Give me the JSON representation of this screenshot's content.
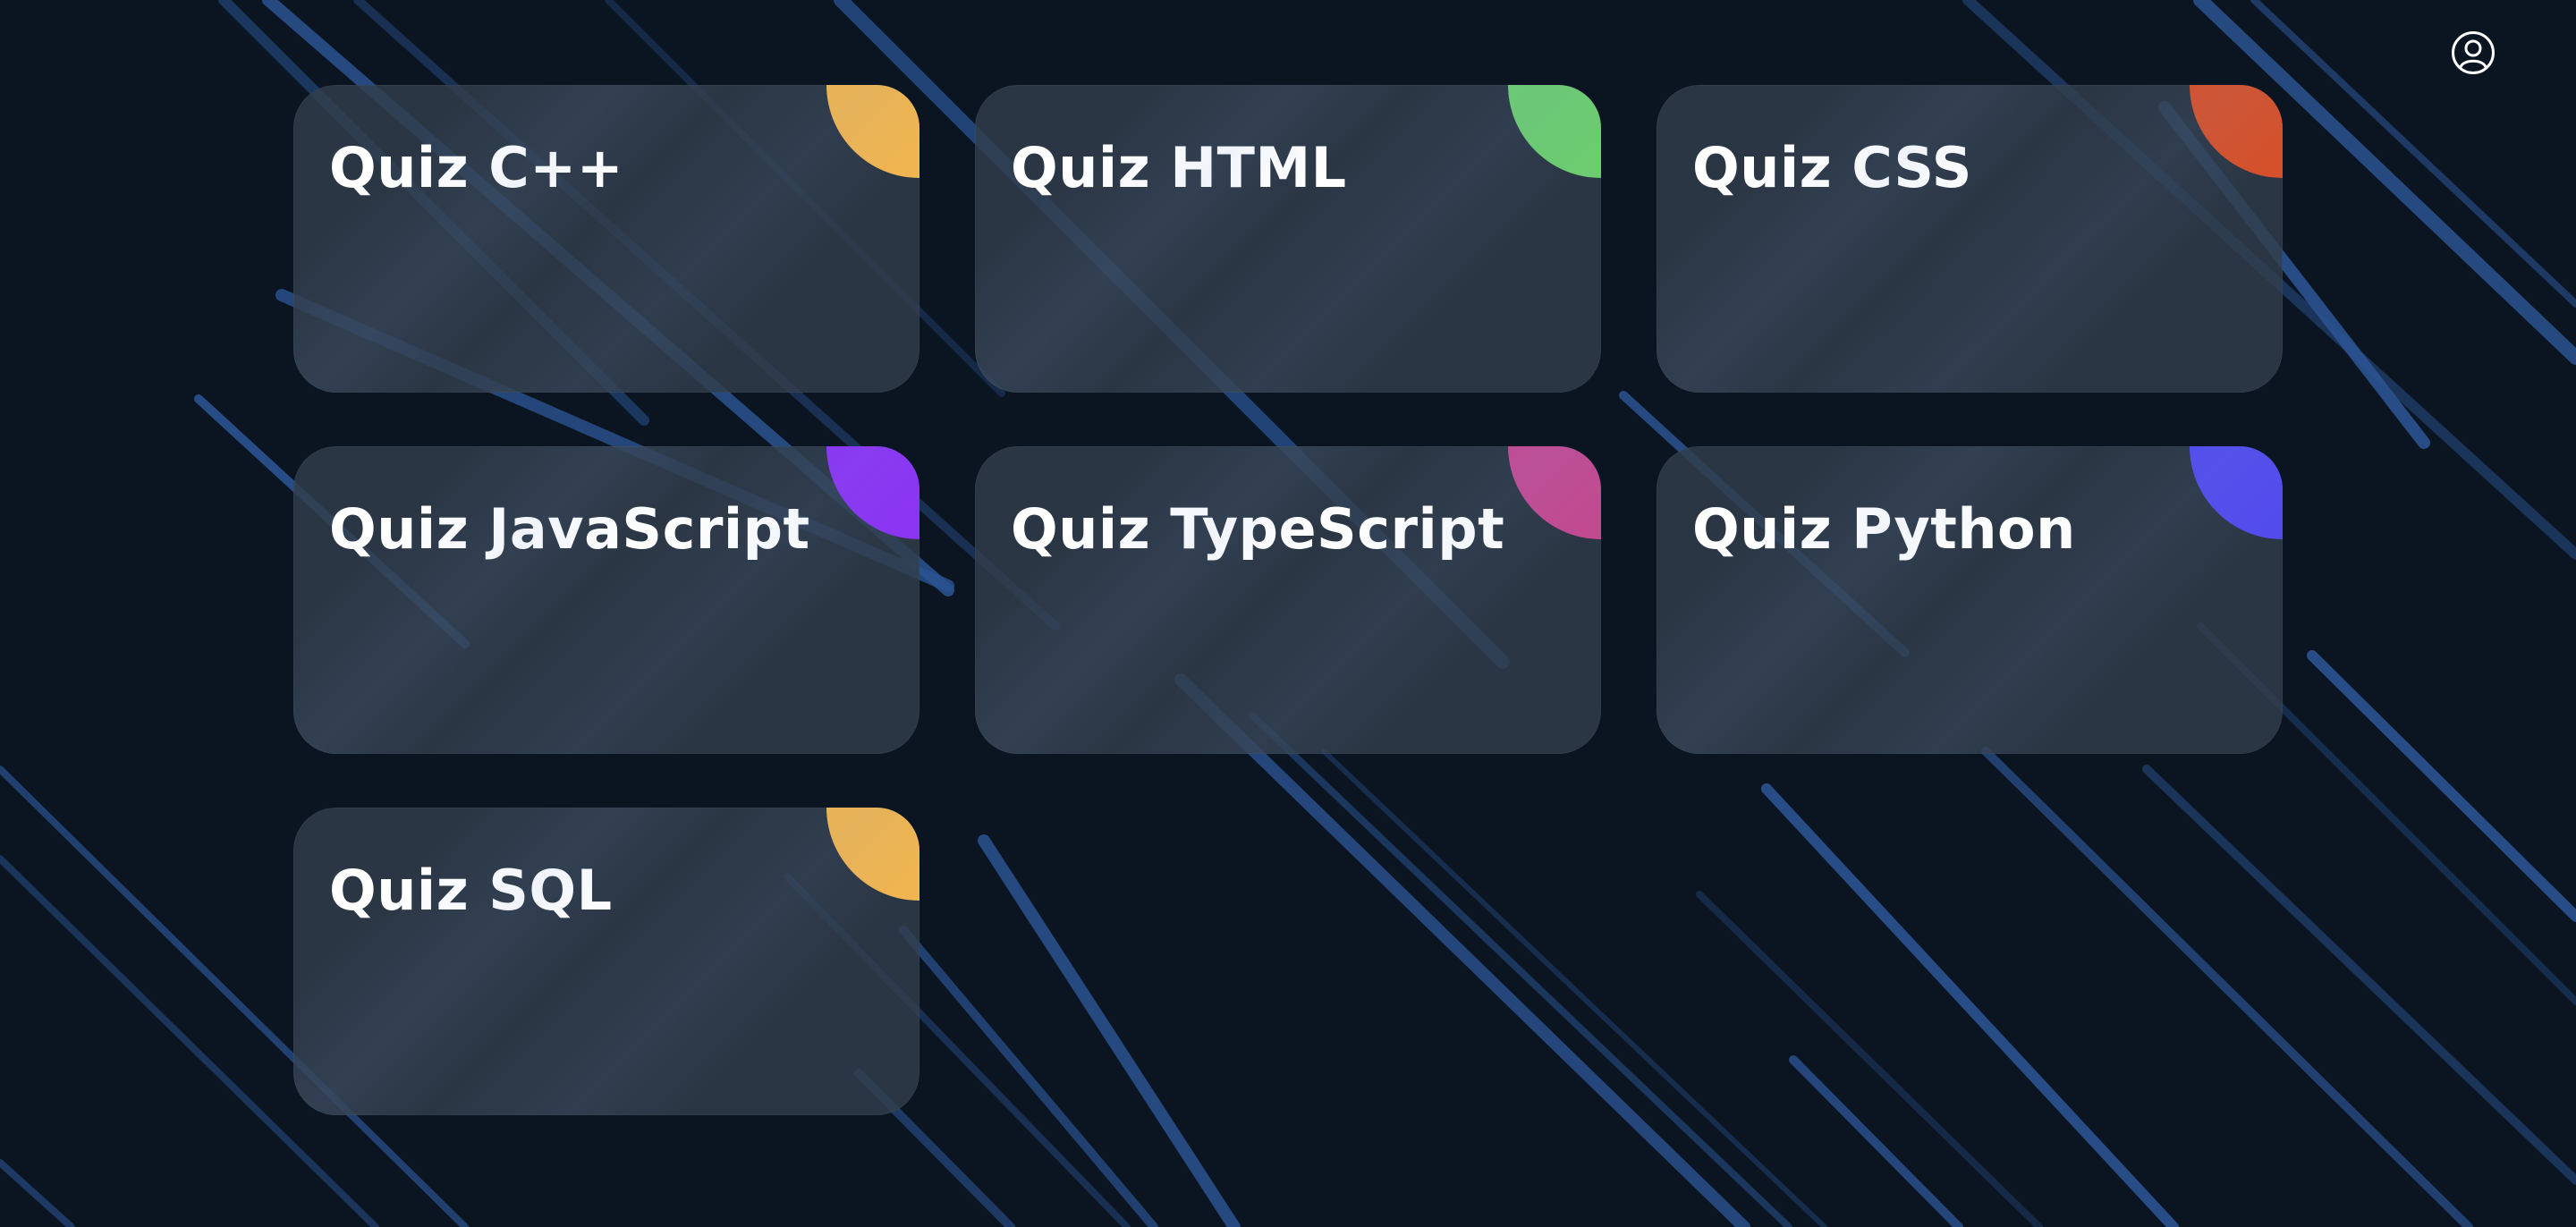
{
  "header": {
    "profile_icon": "user-circle-icon",
    "icon_color": "#ffffff"
  },
  "theme": {
    "background": "#0b1521",
    "line_color": "#2b5391",
    "card_background": "#323e4c",
    "title_color": "#ffffff"
  },
  "quizzes": [
    {
      "title": "Quiz C++",
      "accent": "#f0b550"
    },
    {
      "title": "Quiz HTML",
      "accent": "#6ccc6f"
    },
    {
      "title": "Quiz CSS",
      "accent": "#d4512b"
    },
    {
      "title": "Quiz JavaScript",
      "accent": "#8b34f2"
    },
    {
      "title": "Quiz TypeScript",
      "accent": "#c24a91"
    },
    {
      "title": "Quiz Python",
      "accent": "#534bec"
    },
    {
      "title": "Quiz SQL",
      "accent": "#f0b550"
    }
  ]
}
